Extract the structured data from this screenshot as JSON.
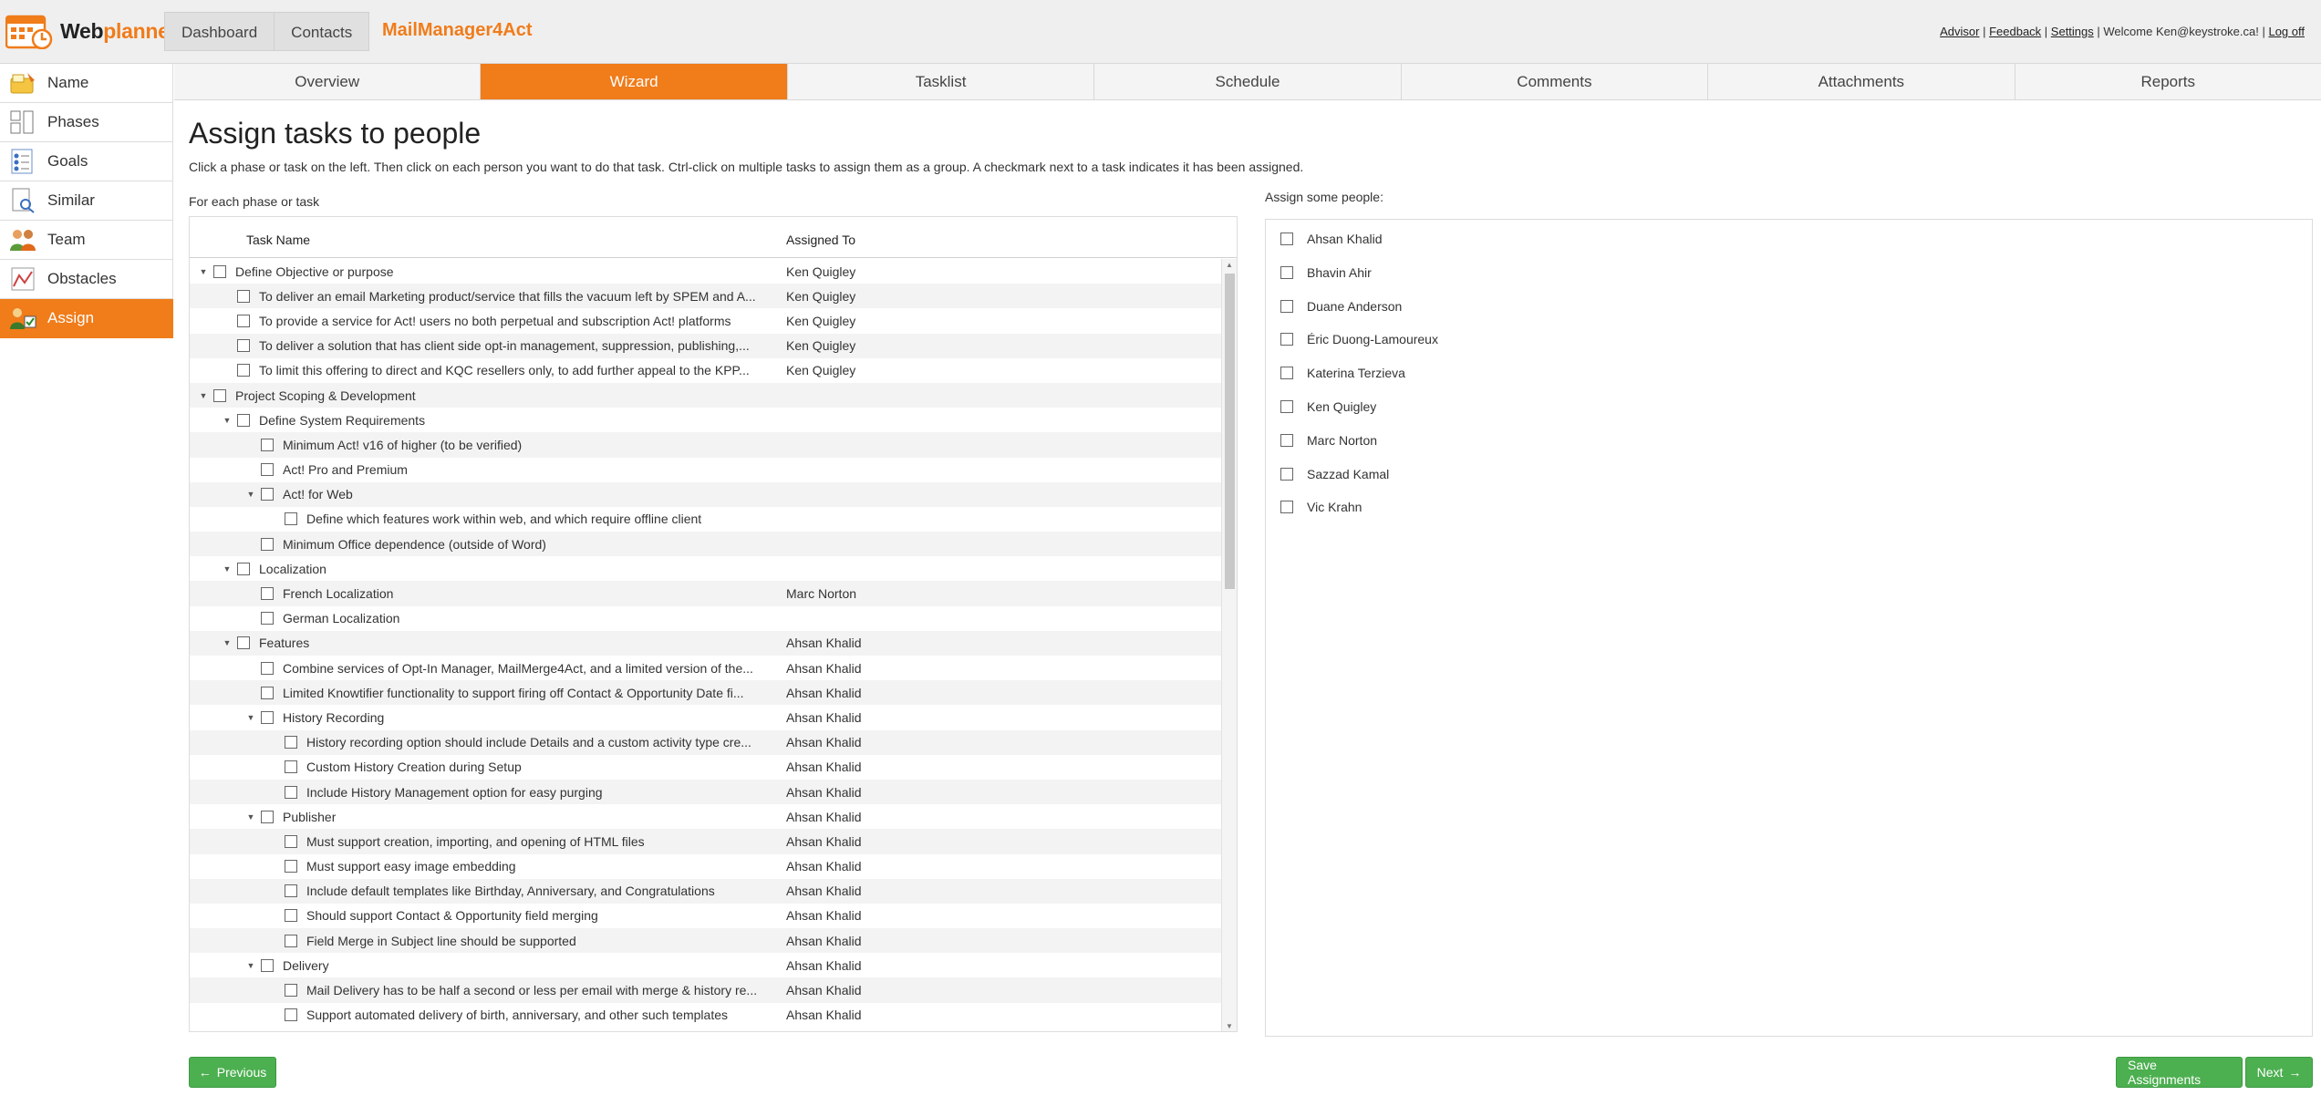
{
  "header": {
    "logo_text_plain": "Web",
    "logo_text_accent": "planner",
    "nav": [
      "Dashboard",
      "Contacts"
    ],
    "app_name": "MailManager4Act",
    "links": {
      "advisor": "Advisor",
      "feedback": "Feedback",
      "settings": "Settings",
      "welcome": "Welcome Ken@keystroke.ca!",
      "logoff": "Log off"
    }
  },
  "sidebar": {
    "items": [
      {
        "label": "Name",
        "icon": "folder-note-icon",
        "active": false
      },
      {
        "label": "Phases",
        "icon": "phases-icon",
        "active": false
      },
      {
        "label": "Goals",
        "icon": "checklist-icon",
        "active": false
      },
      {
        "label": "Similar",
        "icon": "document-search-icon",
        "active": false
      },
      {
        "label": "Team",
        "icon": "team-icon",
        "active": false
      },
      {
        "label": "Obstacles",
        "icon": "chart-obstacle-icon",
        "active": false
      },
      {
        "label": "Assign",
        "icon": "assign-person-icon",
        "active": true
      }
    ]
  },
  "tabs": [
    {
      "label": "Overview",
      "active": false
    },
    {
      "label": "Wizard",
      "active": true
    },
    {
      "label": "Tasklist",
      "active": false
    },
    {
      "label": "Schedule",
      "active": false
    },
    {
      "label": "Comments",
      "active": false
    },
    {
      "label": "Attachments",
      "active": false
    },
    {
      "label": "Reports",
      "active": false
    }
  ],
  "main": {
    "title": "Assign tasks to people",
    "instructions": "Click a phase or task on the left. Then click on each person you want to do that task. Ctrl-click on multiple tasks to assign them as a group. A checkmark next to a task indicates it has been assigned.",
    "left_label": "For each phase or task",
    "right_label": "Assign some people:",
    "columns": {
      "name": "Task Name",
      "assigned": "Assigned To"
    }
  },
  "tasks": [
    {
      "level": 0,
      "expandable": true,
      "name": "Define Objective or purpose",
      "assigned": "Ken Quigley"
    },
    {
      "level": 1,
      "expandable": false,
      "name": "To deliver an email Marketing product/service that fills the vacuum left by SPEM and A...",
      "assigned": "Ken Quigley"
    },
    {
      "level": 1,
      "expandable": false,
      "name": "To provide a service for Act! users no both perpetual and subscription Act! platforms",
      "assigned": "Ken Quigley"
    },
    {
      "level": 1,
      "expandable": false,
      "name": "To deliver a solution that has client side opt-in management, suppression, publishing,...",
      "assigned": "Ken Quigley"
    },
    {
      "level": 1,
      "expandable": false,
      "name": "To limit this offering to direct and KQC resellers only, to add further appeal to the KPP...",
      "assigned": "Ken Quigley"
    },
    {
      "level": 0,
      "expandable": true,
      "name": "Project Scoping & Development",
      "assigned": ""
    },
    {
      "level": 1,
      "expandable": true,
      "name": "Define System Requirements",
      "assigned": ""
    },
    {
      "level": 2,
      "expandable": false,
      "name": "Minimum Act! v16 of higher (to be verified)",
      "assigned": ""
    },
    {
      "level": 2,
      "expandable": false,
      "name": "Act! Pro and Premium",
      "assigned": ""
    },
    {
      "level": 2,
      "expandable": true,
      "name": "Act! for Web",
      "assigned": ""
    },
    {
      "level": 3,
      "expandable": false,
      "name": "Define which features work within web, and which require offline client",
      "assigned": ""
    },
    {
      "level": 2,
      "expandable": false,
      "name": "Minimum Office dependence (outside of Word)",
      "assigned": ""
    },
    {
      "level": 1,
      "expandable": true,
      "name": "Localization",
      "assigned": ""
    },
    {
      "level": 2,
      "expandable": false,
      "name": "French Localization",
      "assigned": "Marc Norton"
    },
    {
      "level": 2,
      "expandable": false,
      "name": "German Localization",
      "assigned": ""
    },
    {
      "level": 1,
      "expandable": true,
      "name": "Features",
      "assigned": "Ahsan Khalid"
    },
    {
      "level": 2,
      "expandable": false,
      "name": "Combine services of Opt-In Manager, MailMerge4Act, and a limited version of the...",
      "assigned": "Ahsan Khalid"
    },
    {
      "level": 2,
      "expandable": false,
      "name": "Limited Knowtifier functionality to support firing off Contact & Opportunity Date fi...",
      "assigned": "Ahsan Khalid"
    },
    {
      "level": 2,
      "expandable": true,
      "name": "History Recording",
      "assigned": "Ahsan Khalid"
    },
    {
      "level": 3,
      "expandable": false,
      "name": "History recording option should include Details and a custom activity type cre...",
      "assigned": "Ahsan Khalid"
    },
    {
      "level": 3,
      "expandable": false,
      "name": "Custom History Creation during Setup",
      "assigned": "Ahsan Khalid"
    },
    {
      "level": 3,
      "expandable": false,
      "name": "Include History Management option for easy purging",
      "assigned": "Ahsan Khalid"
    },
    {
      "level": 2,
      "expandable": true,
      "name": "Publisher",
      "assigned": "Ahsan Khalid"
    },
    {
      "level": 3,
      "expandable": false,
      "name": "Must support creation, importing, and opening of HTML files",
      "assigned": "Ahsan Khalid"
    },
    {
      "level": 3,
      "expandable": false,
      "name": "Must support easy image embedding",
      "assigned": "Ahsan Khalid"
    },
    {
      "level": 3,
      "expandable": false,
      "name": "Include default templates like Birthday, Anniversary, and Congratulations",
      "assigned": "Ahsan Khalid"
    },
    {
      "level": 3,
      "expandable": false,
      "name": "Should support Contact & Opportunity field merging",
      "assigned": "Ahsan Khalid"
    },
    {
      "level": 3,
      "expandable": false,
      "name": "Field Merge in Subject line should be supported",
      "assigned": "Ahsan Khalid"
    },
    {
      "level": 2,
      "expandable": true,
      "name": "Delivery",
      "assigned": "Ahsan Khalid"
    },
    {
      "level": 3,
      "expandable": false,
      "name": "Mail Delivery has to be half a second or less per email with merge & history re...",
      "assigned": "Ahsan Khalid"
    },
    {
      "level": 3,
      "expandable": false,
      "name": "Support automated delivery of birth, anniversary, and other such templates",
      "assigned": "Ahsan Khalid"
    }
  ],
  "people": [
    "Ahsan Khalid",
    "Bhavin Ahir",
    "Duane Anderson",
    "Éric Duong-Lamoureux",
    "Katerina Terzieva",
    "Ken Quigley",
    "Marc Norton",
    "Sazzad Kamal",
    "Vic Krahn"
  ],
  "buttons": {
    "previous": "Previous",
    "save": "Save Assignments",
    "next": "Next"
  },
  "colors": {
    "accent": "#f07c1a",
    "button": "#4caf50"
  }
}
